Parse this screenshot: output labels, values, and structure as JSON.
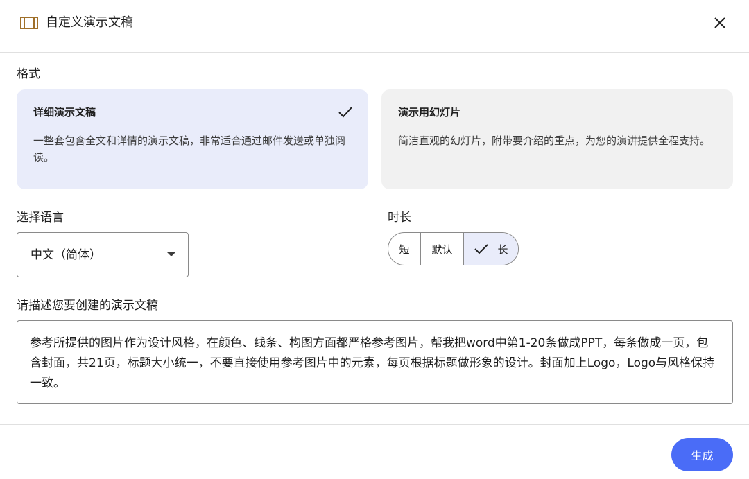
{
  "dialog": {
    "title": "自定义演示文稿",
    "icon": "slides-icon",
    "close_icon": "close-icon"
  },
  "format": {
    "label": "格式",
    "options": [
      {
        "title": "详细演示文稿",
        "description": "一整套包含全文和详情的演示文稿，非常适合通过邮件发送或单独阅读。",
        "selected": true
      },
      {
        "title": "演示用幻灯片",
        "description": "简洁直观的幻灯片，附带要介绍的重点，为您的演讲提供全程支持。",
        "selected": false
      }
    ]
  },
  "language": {
    "label": "选择语言",
    "selected": "中文（简体）"
  },
  "duration": {
    "label": "时长",
    "options": [
      "短",
      "默认",
      "长"
    ],
    "selected": "长"
  },
  "description": {
    "label": "请描述您要创建的演示文稿",
    "value": "参考所提供的图片作为设计风格，在颜色、线条、构图方面都严格参考图片，帮我把word中第1-20条做成PPT，每条做成一页，包含封面，共21页，标题大小统一，不要直接使用参考图片中的元素，每页根据标题做形象的设计。封面加上Logo，Logo与风格保持一致。"
  },
  "footer": {
    "generate_label": "生成"
  },
  "colors": {
    "accent": "#4a6cf7",
    "selected_bg": "#e9ecfa",
    "card_bg": "#f1f1f1",
    "icon_brown": "#a0702a"
  }
}
